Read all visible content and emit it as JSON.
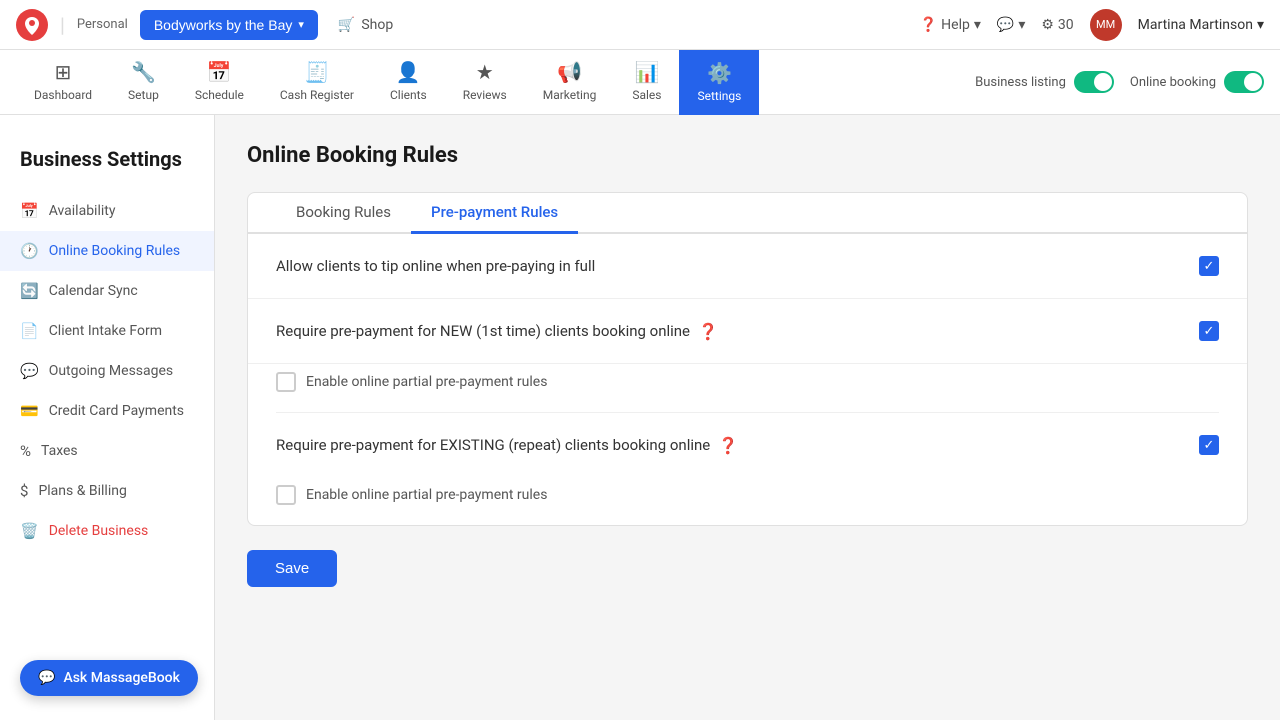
{
  "topbar": {
    "personal_label": "Personal",
    "business_name": "Bodyworks by the Bay",
    "shop_label": "Shop",
    "help_label": "Help",
    "notifications_count": "30",
    "user_name": "Martina Martinson"
  },
  "nav": {
    "items": [
      {
        "id": "dashboard",
        "label": "Dashboard",
        "icon": "⊞"
      },
      {
        "id": "setup",
        "label": "Setup",
        "icon": "🔧"
      },
      {
        "id": "schedule",
        "label": "Schedule",
        "icon": "📅"
      },
      {
        "id": "cash-register",
        "label": "Cash Register",
        "icon": "🧾"
      },
      {
        "id": "clients",
        "label": "Clients",
        "icon": "👤"
      },
      {
        "id": "reviews",
        "label": "Reviews",
        "icon": "★"
      },
      {
        "id": "marketing",
        "label": "Marketing",
        "icon": "📢"
      },
      {
        "id": "sales",
        "label": "Sales",
        "icon": "📊"
      },
      {
        "id": "settings",
        "label": "Settings",
        "icon": "⚙️",
        "active": true
      }
    ],
    "business_listing_label": "Business listing",
    "online_booking_label": "Online booking"
  },
  "sidebar": {
    "page_title": "Business Settings",
    "items": [
      {
        "id": "availability",
        "label": "Availability",
        "icon": "📅"
      },
      {
        "id": "online-booking-rules",
        "label": "Online Booking Rules",
        "icon": "🕐",
        "active": true
      },
      {
        "id": "calendar-sync",
        "label": "Calendar Sync",
        "icon": "🔄"
      },
      {
        "id": "client-intake-form",
        "label": "Client Intake Form",
        "icon": "📄"
      },
      {
        "id": "outgoing-messages",
        "label": "Outgoing Messages",
        "icon": "💬"
      },
      {
        "id": "credit-card-payments",
        "label": "Credit Card Payments",
        "icon": "💳"
      },
      {
        "id": "taxes",
        "label": "Taxes",
        "icon": "%"
      },
      {
        "id": "plans-billing",
        "label": "Plans & Billing",
        "icon": "$"
      },
      {
        "id": "delete-business",
        "label": "Delete Business",
        "icon": "🗑️",
        "delete": true
      }
    ]
  },
  "main": {
    "section_title": "Online Booking Rules",
    "tabs": [
      {
        "id": "booking-rules",
        "label": "Booking Rules",
        "active": false
      },
      {
        "id": "pre-payment-rules",
        "label": "Pre-payment Rules",
        "active": true
      }
    ],
    "rules": [
      {
        "id": "tip-online",
        "label": "Allow clients to tip online when pre-paying in full",
        "checked": true,
        "has_help": false,
        "has_sub": false
      },
      {
        "id": "new-client-prepayment",
        "label": "Require pre-payment for NEW (1st time) clients booking online",
        "checked": true,
        "has_help": true,
        "has_sub": true,
        "sub_label": "Enable online partial pre-payment rules",
        "sub_checked": false
      },
      {
        "id": "existing-client-prepayment",
        "label": "Require pre-payment for EXISTING (repeat) clients booking online",
        "checked": true,
        "has_help": true,
        "has_sub": true,
        "sub_label": "Enable online partial pre-payment rules",
        "sub_checked": false
      }
    ],
    "save_button": "Save"
  },
  "chat_fab": "Ask MassageBook"
}
